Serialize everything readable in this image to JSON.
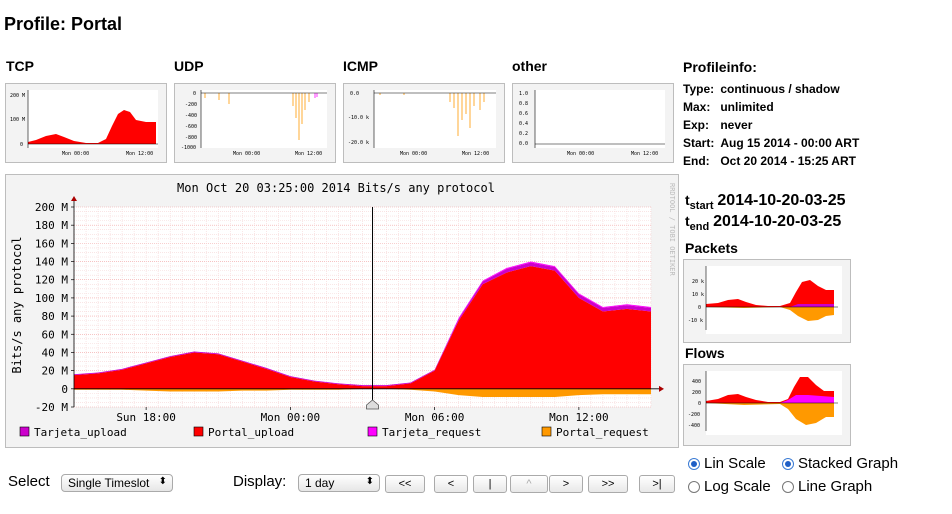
{
  "page": {
    "title": "Profile: Portal"
  },
  "protocols": [
    {
      "label": "TCP",
      "ylabels": [
        "200 M",
        "100 M",
        "0"
      ]
    },
    {
      "label": "UDP",
      "ylabels": [
        "0",
        "-200",
        "-400",
        "-600",
        "-800",
        "-1000"
      ]
    },
    {
      "label": "ICMP",
      "ylabels": [
        "0.0",
        "-10.0 k",
        "-20.0 k"
      ]
    },
    {
      "label": "other",
      "ylabels": [
        "1.0",
        "0.8",
        "0.6",
        "0.4",
        "0.2",
        "0.0"
      ]
    }
  ],
  "thumb_xlabels": [
    "Mon 00:00",
    "Mon 12:00"
  ],
  "profileinfo": {
    "heading": "Profileinfo:",
    "rows": [
      {
        "k": "Type:",
        "v": "continuous / shadow"
      },
      {
        "k": "Max:",
        "v": "unlimited"
      },
      {
        "k": "Exp:",
        "v": "never"
      },
      {
        "k": "Start:",
        "v": "Aug 15 2014 - 00:00 ART"
      },
      {
        "k": "End:",
        "v": "Oct 20 2014 - 15:25 ART"
      }
    ]
  },
  "tstart": {
    "t": "t",
    "sub": "start",
    "value": "2014-10-20-03-25"
  },
  "tend": {
    "t": "t",
    "sub": "end",
    "value": "2014-10-20-03-25"
  },
  "side": {
    "packets": {
      "label": "Packets",
      "ylabels": [
        "20 k",
        "10 k",
        "0",
        "-10 k"
      ]
    },
    "flows": {
      "label": "Flows",
      "ylabels": [
        "400",
        "200",
        "0",
        "-200",
        "-400"
      ]
    }
  },
  "main_chart": {
    "title": "Mon Oct 20 03:25:00 2014 Bits/s any protocol",
    "ylabel": "Bits/s any protocol",
    "watermark": "RRDTOOL / TOBI OETIKER",
    "yticks": [
      "200 M",
      "180 M",
      "160 M",
      "140 M",
      "120 M",
      "100 M",
      "80 M",
      "60 M",
      "40 M",
      "20 M",
      "0",
      "-20 M"
    ],
    "xticks": [
      "Sun 18:00",
      "Mon 00:00",
      "Mon 06:00",
      "Mon 12:00"
    ],
    "legend": [
      {
        "name": "Tarjeta_upload",
        "color": "#cc00cc"
      },
      {
        "name": "Portal_upload",
        "color": "#ff0000"
      },
      {
        "name": "Tarjeta_request",
        "color": "#ff00ff"
      },
      {
        "name": "Portal_request",
        "color": "#ff9900"
      }
    ]
  },
  "chart_data": {
    "type": "area",
    "title": "Mon Oct 20 03:25:00 2014 Bits/s any protocol",
    "ylabel": "Bits/s any protocol",
    "ylim": [
      -20,
      200
    ],
    "y_unit": "M",
    "x": [
      "Sun 15:00",
      "Sun 16:00",
      "Sun 17:00",
      "Sun 18:00",
      "Sun 19:00",
      "Sun 20:00",
      "Sun 21:00",
      "Sun 22:00",
      "Sun 23:00",
      "Mon 00:00",
      "Mon 01:00",
      "Mon 02:00",
      "Mon 03:00",
      "Mon 04:00",
      "Mon 05:00",
      "Mon 06:00",
      "Mon 07:00",
      "Mon 08:00",
      "Mon 09:00",
      "Mon 10:00",
      "Mon 11:00",
      "Mon 12:00",
      "Mon 13:00",
      "Mon 14:00",
      "Mon 15:00"
    ],
    "xticks": [
      "Sun 18:00",
      "Mon 00:00",
      "Mon 06:00",
      "Mon 12:00"
    ],
    "series": [
      {
        "name": "Portal_upload",
        "color": "#ff0000",
        "values": [
          15,
          17,
          21,
          28,
          35,
          40,
          38,
          30,
          22,
          13,
          8,
          5,
          3,
          3,
          6,
          20,
          75,
          115,
          128,
          135,
          130,
          100,
          85,
          88,
          85
        ]
      },
      {
        "name": "Tarjeta_upload",
        "color": "#cc00cc",
        "values": [
          1,
          1,
          1,
          1,
          1,
          1,
          1,
          1,
          1,
          1,
          1,
          1,
          1,
          1,
          1,
          1,
          2,
          3,
          4,
          4,
          4,
          4,
          4,
          4,
          4
        ]
      },
      {
        "name": "Tarjeta_request",
        "color": "#ff00ff",
        "values": [
          0,
          0,
          0,
          0,
          0,
          0,
          0,
          0,
          0,
          0,
          0,
          0,
          0,
          0,
          0,
          0,
          1,
          1,
          1,
          1,
          1,
          1,
          1,
          1,
          1
        ]
      },
      {
        "name": "Portal_request",
        "color": "#ff9900",
        "values": [
          -1,
          -1,
          -1,
          -2,
          -3,
          -3,
          -3,
          -2,
          -2,
          -1,
          -1,
          -1,
          0,
          0,
          -1,
          -3,
          -7,
          -9,
          -9,
          -9,
          -9,
          -7,
          -6,
          -6,
          -6
        ]
      }
    ],
    "cursor_x": "Mon 03:25",
    "grid": true
  },
  "controls": {
    "select_label": "Select",
    "select_value": "Single Timeslot",
    "display_label": "Display:",
    "display_value": "1 day",
    "nav": [
      "<<",
      "<",
      "|",
      "^",
      ">",
      ">>",
      ">|"
    ],
    "lin_scale": "Lin Scale",
    "log_scale": "Log Scale",
    "stacked_graph": "Stacked Graph",
    "line_graph": "Line Graph"
  }
}
